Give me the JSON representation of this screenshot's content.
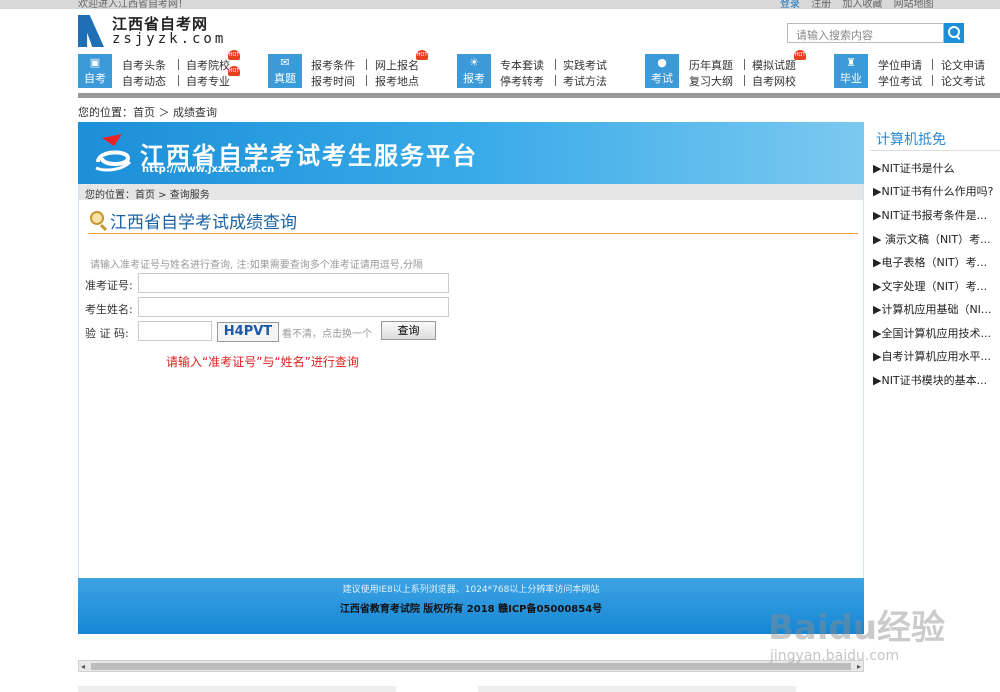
{
  "topbar": {
    "welcome": "欢迎进入江西省自考网！",
    "login": "登录",
    "register": "注册",
    "join": "加入收藏",
    "sitemap": "网站地图"
  },
  "logo": {
    "cn": "江西省自考网",
    "en": "zsjyzk.com"
  },
  "search": {
    "placeholder": "请输入搜索内容"
  },
  "nav": {
    "groups": [
      {
        "icon": "自考",
        "links": [
          "自考头条",
          "自考院校",
          "自考动态",
          "自考专业"
        ]
      },
      {
        "icon": "真题",
        "links": [
          "报考条件",
          "网上报名",
          "报考时间",
          "报考地点"
        ]
      },
      {
        "icon": "报考",
        "links": [
          "专本套读",
          "实践考试",
          "停考转考",
          "考试方法"
        ]
      },
      {
        "icon": "考试",
        "links": [
          "历年真题",
          "模拟试题",
          "复习大纲",
          "自考网校"
        ]
      },
      {
        "icon": "毕业",
        "links": [
          "学位申请",
          "论文申请",
          "学位考试",
          "论文考试"
        ]
      }
    ],
    "hot_badge": "HOT"
  },
  "breadcrumb": "您的位置：首页 ＞ 成绩查询",
  "banner": {
    "title": "江西省自学考试考生服务平台",
    "url": "http://www.jxzk.com.cn"
  },
  "crumb2": "您的位置：首页 > 查询服务",
  "heading": "江西省自学考试成绩查询",
  "hint": "请输入准考证号与姓名进行查询, 注:如果需要查询多个准考证请用逗号,分隔",
  "form": {
    "ticket_label": "准考证号:",
    "name_label": "考生姓名:",
    "captcha_label": "验 证 码:",
    "captcha_code": "H4PVT",
    "captcha_refresh": "看不清，点击换一个",
    "submit": "查询"
  },
  "notice": "请输入“准考证号”与“姓名”进行查询",
  "footer": {
    "line1": "建议使用IE8以上系列浏览器、1024*768以上分辨率访问本网站",
    "line2": "江西省教育考试院  版权所有  2018  赣ICP备05000854号"
  },
  "sidebar": {
    "title": "计算机抵免",
    "items": [
      "▶NIT证书是什么",
      "▶NIT证书有什么作用吗?",
      "▶NIT证书报考条件是...",
      "▶ 演示文稿（NIT）考...",
      "▶电子表格（NIT）考...",
      "▶文字处理（NIT）考...",
      "▶计算机应用基础（NI...",
      "▶全国计算机应用技术...",
      "▶自考计算机应用水平...",
      "▶NIT证书模块的基本..."
    ]
  },
  "watermark": {
    "main": "Baidu经验",
    "sub": "jingyan.baidu.com"
  },
  "colors": {
    "accent": "#1b8fd8",
    "nav_icon": "#3d9ad9",
    "heading": "#1a63a8",
    "notice": "#dd2222"
  }
}
